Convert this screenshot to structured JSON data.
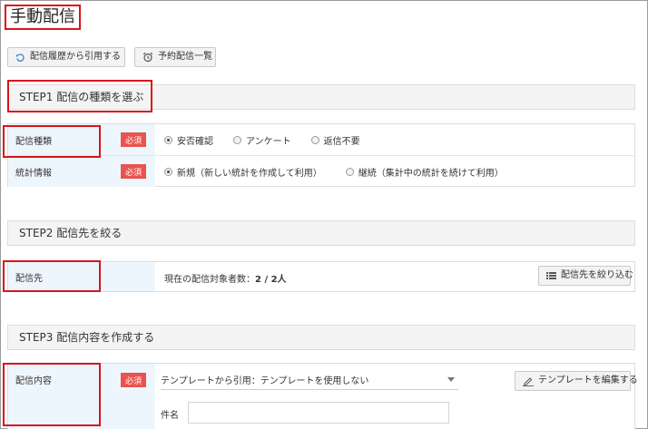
{
  "page_title": "手動配信",
  "toolbar": {
    "history_button": "配信履歴から引用する",
    "scheduled_button": "予約配信一覧"
  },
  "step1": {
    "header": "STEP1 配信の種類を選ぶ",
    "required_badge": "必須",
    "delivery_type": {
      "label": "配信種類",
      "options": [
        "安否確認",
        "アンケート",
        "返信不要"
      ],
      "selected": 0
    },
    "statistics": {
      "label": "統計情報",
      "options": [
        "新規（新しい統計を作成して利用）",
        "継続（集計中の統計を続けて利用）"
      ],
      "selected": 0
    }
  },
  "step2": {
    "header": "STEP2 配信先を絞る",
    "recipients": {
      "label": "配信先",
      "count_prefix": "現在の配信対象者数：",
      "count_value": "2 / 2人",
      "filter_button": "配信先を絞り込む"
    }
  },
  "step3": {
    "header": "STEP3 配信内容を作成する",
    "content": {
      "label": "配信内容",
      "required_badge": "必須",
      "template_prefix": "テンプレートから引用：",
      "template_value": "テンプレートを使用しない",
      "edit_template_button": "テンプレートを編集する",
      "subject_label": "件名",
      "subject_value": ""
    }
  },
  "colors": {
    "highlight": "#d9141b",
    "required": "#e8544f",
    "label_bg": "#eef6fd"
  }
}
